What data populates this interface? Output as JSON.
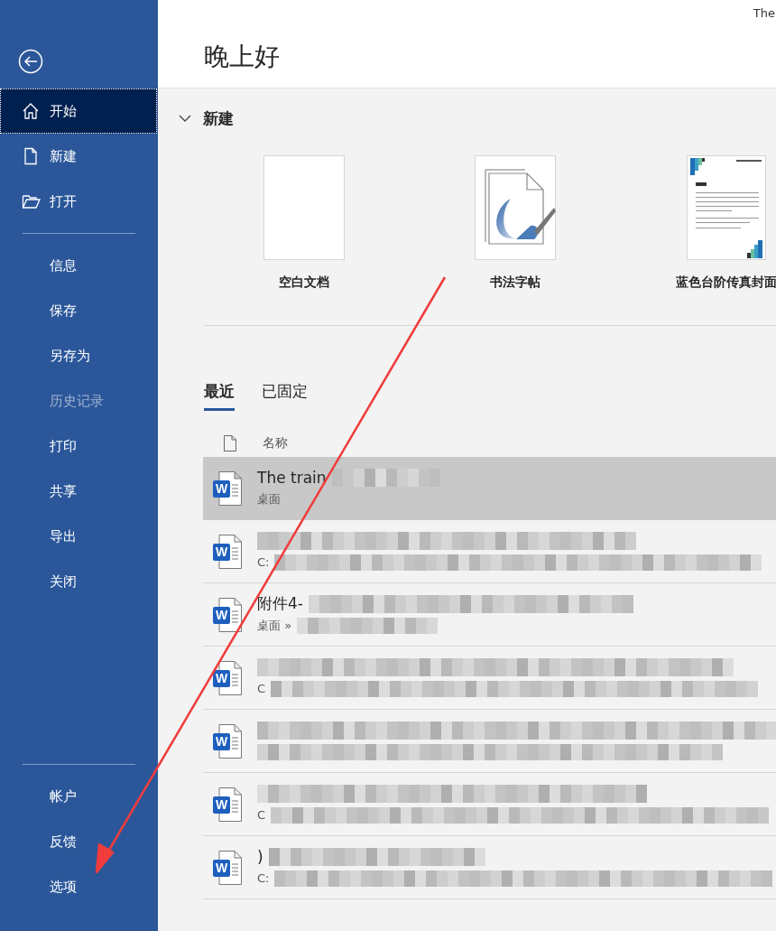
{
  "window": {
    "title": "The"
  },
  "sidebar": {
    "items": [
      {
        "label": "开始",
        "selected": true,
        "disabled": false
      },
      {
        "label": "新建",
        "selected": false,
        "disabled": false
      },
      {
        "label": "打开",
        "selected": false,
        "disabled": false
      },
      {
        "kind": "divider"
      },
      {
        "label": "信息",
        "selected": false,
        "disabled": false
      },
      {
        "label": "保存",
        "selected": false,
        "disabled": false
      },
      {
        "label": "另存为",
        "selected": false,
        "disabled": false
      },
      {
        "label": "历史记录",
        "selected": false,
        "disabled": true
      },
      {
        "label": "打印",
        "selected": false,
        "disabled": false
      },
      {
        "label": "共享",
        "selected": false,
        "disabled": false
      },
      {
        "label": "导出",
        "selected": false,
        "disabled": false
      },
      {
        "label": "关闭",
        "selected": false,
        "disabled": false
      }
    ],
    "bottom_items": [
      {
        "label": "帐户"
      },
      {
        "label": "反馈"
      },
      {
        "label": "选项"
      }
    ]
  },
  "greeting": "晚上好",
  "new_section": {
    "title": "新建",
    "expanded": true,
    "templates": [
      {
        "label": "空白文档",
        "kind": "blank"
      },
      {
        "label": "书法字帖",
        "kind": "calligraphy"
      },
      {
        "label": "蓝色台阶传真封面",
        "kind": "fax"
      }
    ]
  },
  "tabs": [
    {
      "label": "最近",
      "selected": true
    },
    {
      "label": "已固定",
      "selected": false
    }
  ],
  "file_list": {
    "column": "名称",
    "rows": [
      {
        "badge": "W",
        "name": "The train",
        "path": "桌面",
        "selected": true
      },
      {
        "badge": "W",
        "path": "C:",
        "selected": false
      },
      {
        "badge": "W",
        "name": "附件4-",
        "path": "桌面 »",
        "selected": false
      },
      {
        "badge": "W",
        "path": "C",
        "selected": false
      },
      {
        "badge": "W",
        "selected": false
      },
      {
        "badge": "W",
        "path": "C",
        "selected": false
      },
      {
        "badge": "W",
        "name": ")",
        "path": "C:",
        "selected": false
      }
    ]
  }
}
